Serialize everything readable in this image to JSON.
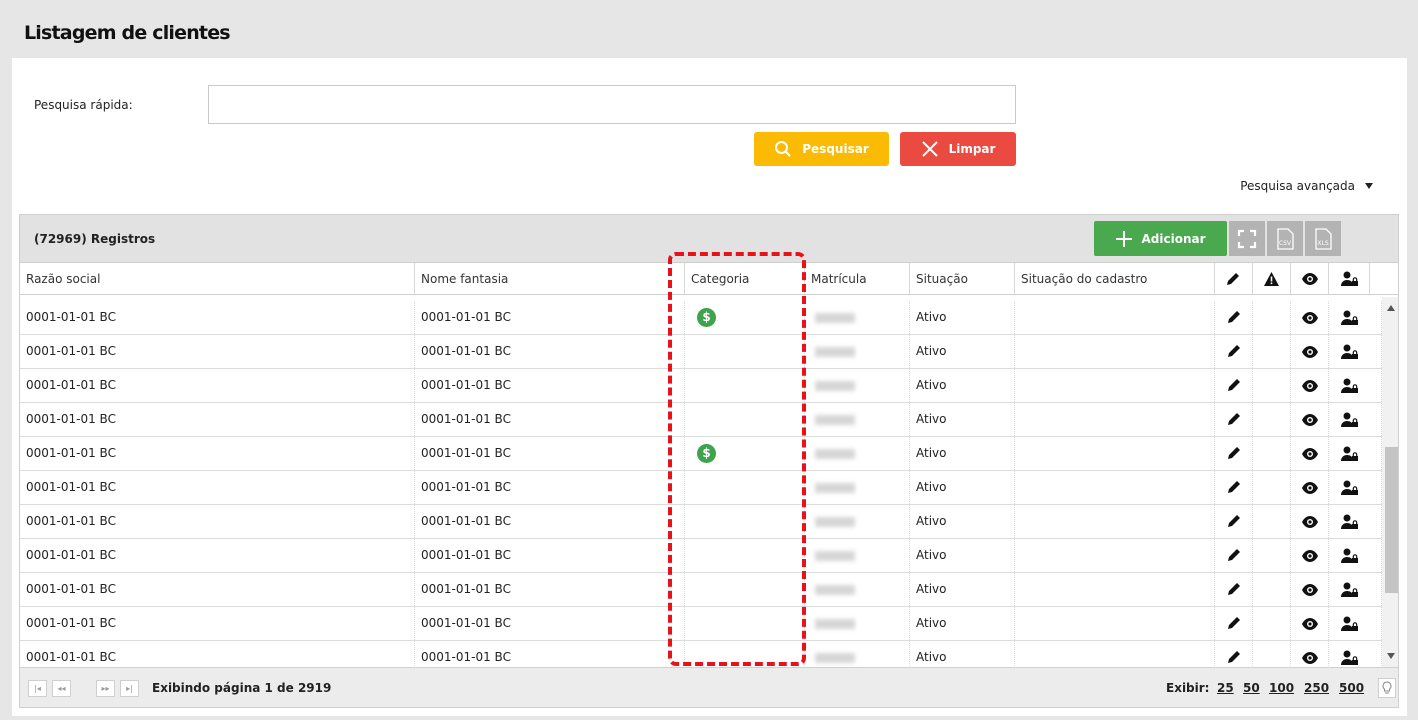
{
  "page": {
    "title": "Listagem de clientes"
  },
  "search": {
    "label": "Pesquisa rápida:",
    "value": "",
    "search_button": "Pesquisar",
    "clear_button": "Limpar",
    "advanced": "Pesquisa avançada"
  },
  "grid": {
    "title": "(72969) Registros",
    "add_button": "Adicionar",
    "toolbar": {
      "csv": "CSV",
      "xls": "XLS"
    },
    "columns": {
      "razao": "Razão social",
      "fantasia": "Nome fantasia",
      "categoria": "Categoria",
      "matricula": "Matrícula",
      "situacao": "Situação",
      "situacao_cadastro": "Situação do cadastro"
    },
    "rows": [
      {
        "razao": "0001-01-01 BC",
        "fantasia": "0001-01-01 BC",
        "situacao": "Ativo",
        "categoria": "dollar"
      },
      {
        "razao": "0001-01-01 BC",
        "fantasia": "0001-01-01 BC",
        "situacao": "Ativo",
        "categoria": ""
      },
      {
        "razao": "0001-01-01 BC",
        "fantasia": "0001-01-01 BC",
        "situacao": "Ativo",
        "categoria": ""
      },
      {
        "razao": "0001-01-01 BC",
        "fantasia": "0001-01-01 BC",
        "situacao": "Ativo",
        "categoria": ""
      },
      {
        "razao": "0001-01-01 BC",
        "fantasia": "0001-01-01 BC",
        "situacao": "Ativo",
        "categoria": "dollar"
      },
      {
        "razao": "0001-01-01 BC",
        "fantasia": "0001-01-01 BC",
        "situacao": "Ativo",
        "categoria": ""
      },
      {
        "razao": "0001-01-01 BC",
        "fantasia": "0001-01-01 BC",
        "situacao": "Ativo",
        "categoria": ""
      },
      {
        "razao": "0001-01-01 BC",
        "fantasia": "0001-01-01 BC",
        "situacao": "Ativo",
        "categoria": ""
      },
      {
        "razao": "0001-01-01 BC",
        "fantasia": "0001-01-01 BC",
        "situacao": "Ativo",
        "categoria": ""
      },
      {
        "razao": "0001-01-01 BC",
        "fantasia": "0001-01-01 BC",
        "situacao": "Ativo",
        "categoria": ""
      },
      {
        "razao": "0001-01-01 BC",
        "fantasia": "0001-01-01 BC",
        "situacao": "Ativo",
        "categoria": ""
      }
    ],
    "category_icon_symbol": "$",
    "footer": {
      "page_info": "Exibindo página 1 de 2919",
      "show_label": "Exibir:",
      "page_sizes": [
        "25",
        "50",
        "100",
        "250",
        "500"
      ]
    }
  },
  "colors": {
    "search_button": "#fbbb05",
    "clear_button": "#ea4a3f",
    "add_button": "#4aa84f",
    "category_icon": "#3fa34d",
    "highlight": "#e8121b"
  }
}
